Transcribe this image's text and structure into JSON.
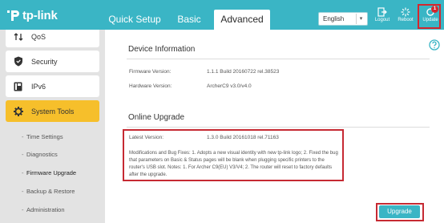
{
  "brand": {
    "logo_text": "tp-link"
  },
  "tabs": [
    {
      "label": "Quick Setup"
    },
    {
      "label": "Basic"
    },
    {
      "label": "Advanced",
      "active": true
    }
  ],
  "language": {
    "selected": "English"
  },
  "header_buttons": {
    "logout": {
      "label": "Logout",
      "icon": "logout-icon"
    },
    "reboot": {
      "label": "Reboot",
      "icon": "reboot-icon"
    },
    "update": {
      "label": "Update",
      "icon": "update-icon",
      "badge": "1"
    }
  },
  "sidebar": {
    "items": [
      {
        "label": "QoS",
        "icon": "qos-icon"
      },
      {
        "label": "Security",
        "icon": "shield-icon"
      },
      {
        "label": "IPv6",
        "icon": "ipv6-icon"
      },
      {
        "label": "System Tools",
        "icon": "gear-icon",
        "active": true
      }
    ],
    "subitems": [
      {
        "label": "Time Settings"
      },
      {
        "label": "Diagnostics"
      },
      {
        "label": "Firmware Upgrade",
        "active": true
      },
      {
        "label": "Backup & Restore"
      },
      {
        "label": "Administration"
      }
    ]
  },
  "device_info": {
    "title": "Device Information",
    "firmware_label": "Firmware Version:",
    "firmware_value": "1.1.1 Build 20160722 rel.38523",
    "hardware_label": "Hardware Version:",
    "hardware_value": "ArcherC9 v3.0/v4.0"
  },
  "online_upgrade": {
    "title": "Online Upgrade",
    "latest_label": "Latest Version:",
    "latest_value": "1.3.0 Build 20161018 rel.71163",
    "notes": "Modifications and Bug Fixes: 1. Adopts a new visual identity with new tp-link logo; 2. Fixed the bug that parameters on Basic & Status pages will be blank when plugging specific printers to the router's USB slot. Notes: 1. For Archer C9(EU) V3/V4; 2. The router will reset to factory defaults after the upgrade.",
    "button_label": "Upgrade"
  },
  "colors": {
    "header": "#3ab5c5",
    "active_sidebar": "#f6bf2b",
    "highlight_border": "#c62a33",
    "button": "#3ab5c5"
  }
}
